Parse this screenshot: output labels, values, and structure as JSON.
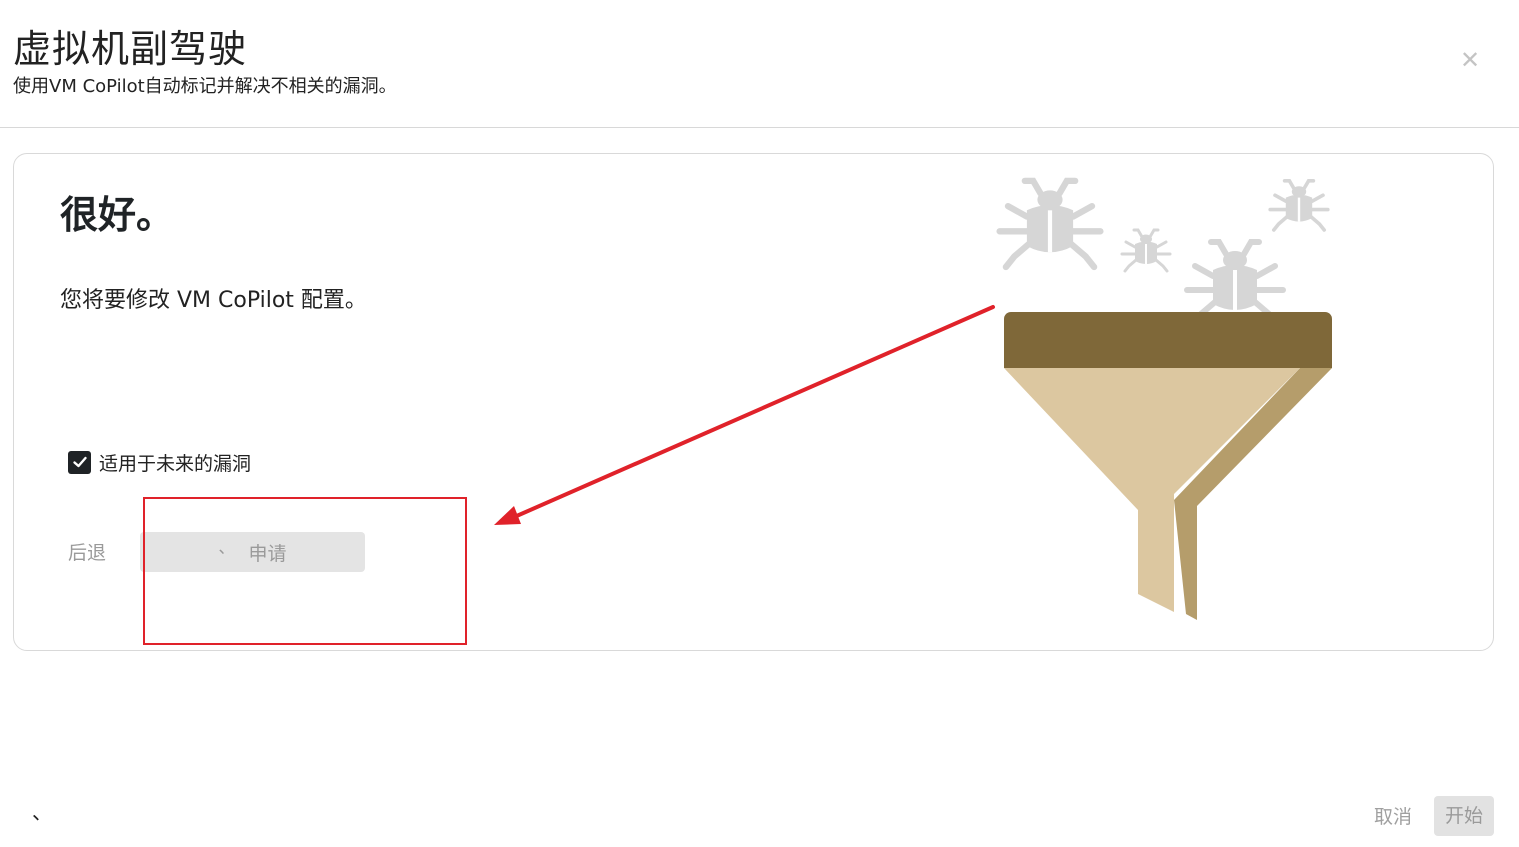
{
  "header": {
    "title": "虚拟机副驾驶",
    "subtitle": "使用VM CoPilot自动标记并解决不相关的漏洞。",
    "close_icon": "close-icon"
  },
  "card": {
    "heading": "很好。",
    "description": "您将要修改 VM CoPilot 配置。",
    "checkbox": {
      "label": "适用于未来的漏洞",
      "checked": true
    },
    "back_label": "后退",
    "apply_tick": "、",
    "apply_label": "申请"
  },
  "illustration": {
    "icons": [
      "bug-icon",
      "funnel-icon"
    ],
    "colors": {
      "funnel_rim": "#7f6839",
      "funnel_body": "#dcc7a0",
      "funnel_shade": "#b59d6b",
      "bug": "#d6d6d6"
    }
  },
  "annotation": {
    "color": "#e0222a"
  },
  "footer": {
    "mark": "、",
    "cancel_label": "取消",
    "start_label": "开始"
  }
}
